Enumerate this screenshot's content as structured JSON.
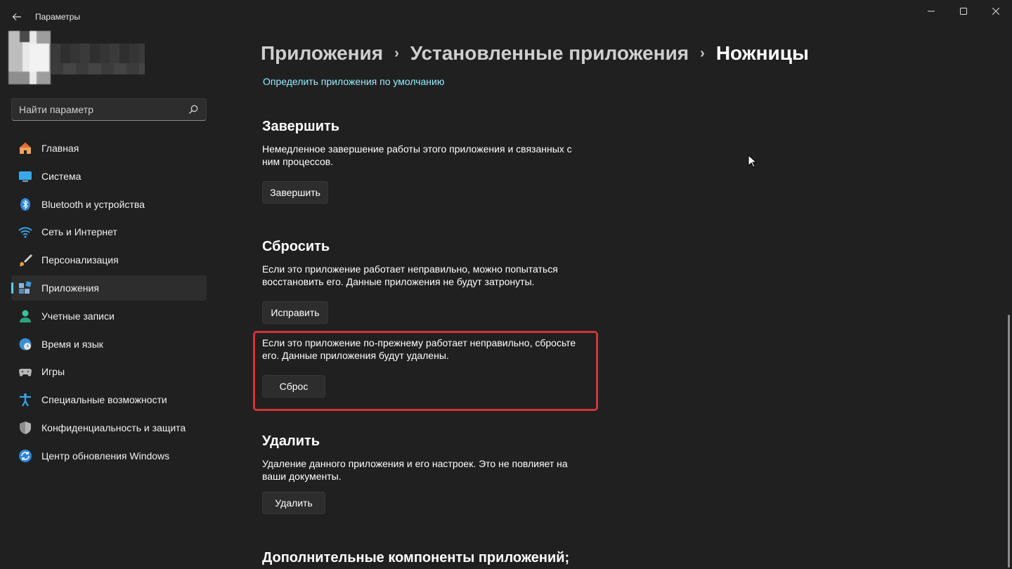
{
  "window": {
    "title": "Параметры",
    "back_icon": "arrow-left-icon",
    "minimize_icon": "minimize-icon",
    "maximize_icon": "maximize-icon",
    "close_icon": "close-icon"
  },
  "search": {
    "placeholder": "Найти параметр"
  },
  "sidebar": {
    "items": [
      {
        "label": "Главная",
        "icon": "home-icon"
      },
      {
        "label": "Система",
        "icon": "monitor-icon"
      },
      {
        "label": "Bluetooth и устройства",
        "icon": "bluetooth-icon"
      },
      {
        "label": "Сеть и Интернет",
        "icon": "wifi-icon"
      },
      {
        "label": "Персонализация",
        "icon": "brush-icon"
      },
      {
        "label": "Приложения",
        "icon": "apps-icon",
        "active": true
      },
      {
        "label": "Учетные записи",
        "icon": "person-icon"
      },
      {
        "label": "Время и язык",
        "icon": "clock-globe-icon"
      },
      {
        "label": "Игры",
        "icon": "gamepad-icon"
      },
      {
        "label": "Специальные возможности",
        "icon": "accessibility-icon"
      },
      {
        "label": "Конфиденциальность и защита",
        "icon": "shield-icon"
      },
      {
        "label": "Центр обновления Windows",
        "icon": "update-icon"
      }
    ]
  },
  "breadcrumb": {
    "items": [
      "Приложения",
      "Установленные приложения",
      "Ножницы"
    ],
    "separator": "›"
  },
  "main": {
    "default_apps_link": "Определить приложения по умолчанию",
    "terminate": {
      "title": "Завершить",
      "description": "Немедленное завершение работы этого приложения и связанных с ним процессов.",
      "button": "Завершить"
    },
    "reset": {
      "title": "Сбросить",
      "repair_description": "Если это приложение работает неправильно, можно попытаться восстановить его. Данные приложения не будут затронуты.",
      "repair_button": "Исправить",
      "reset_description": "Если это приложение по-прежнему работает неправильно, сбросьте его. Данные приложения будут удалены.",
      "reset_button": "Сброс"
    },
    "uninstall": {
      "title": "Удалить",
      "description": "Удаление данного приложения и его настроек. Это не повлияет на ваши документы.",
      "button": "Удалить"
    },
    "addons_title": "Дополнительные компоненты приложений;"
  },
  "colors": {
    "background": "#202020",
    "accent": "#60cdff",
    "link": "#99ebff",
    "highlight_border": "#d13438"
  }
}
